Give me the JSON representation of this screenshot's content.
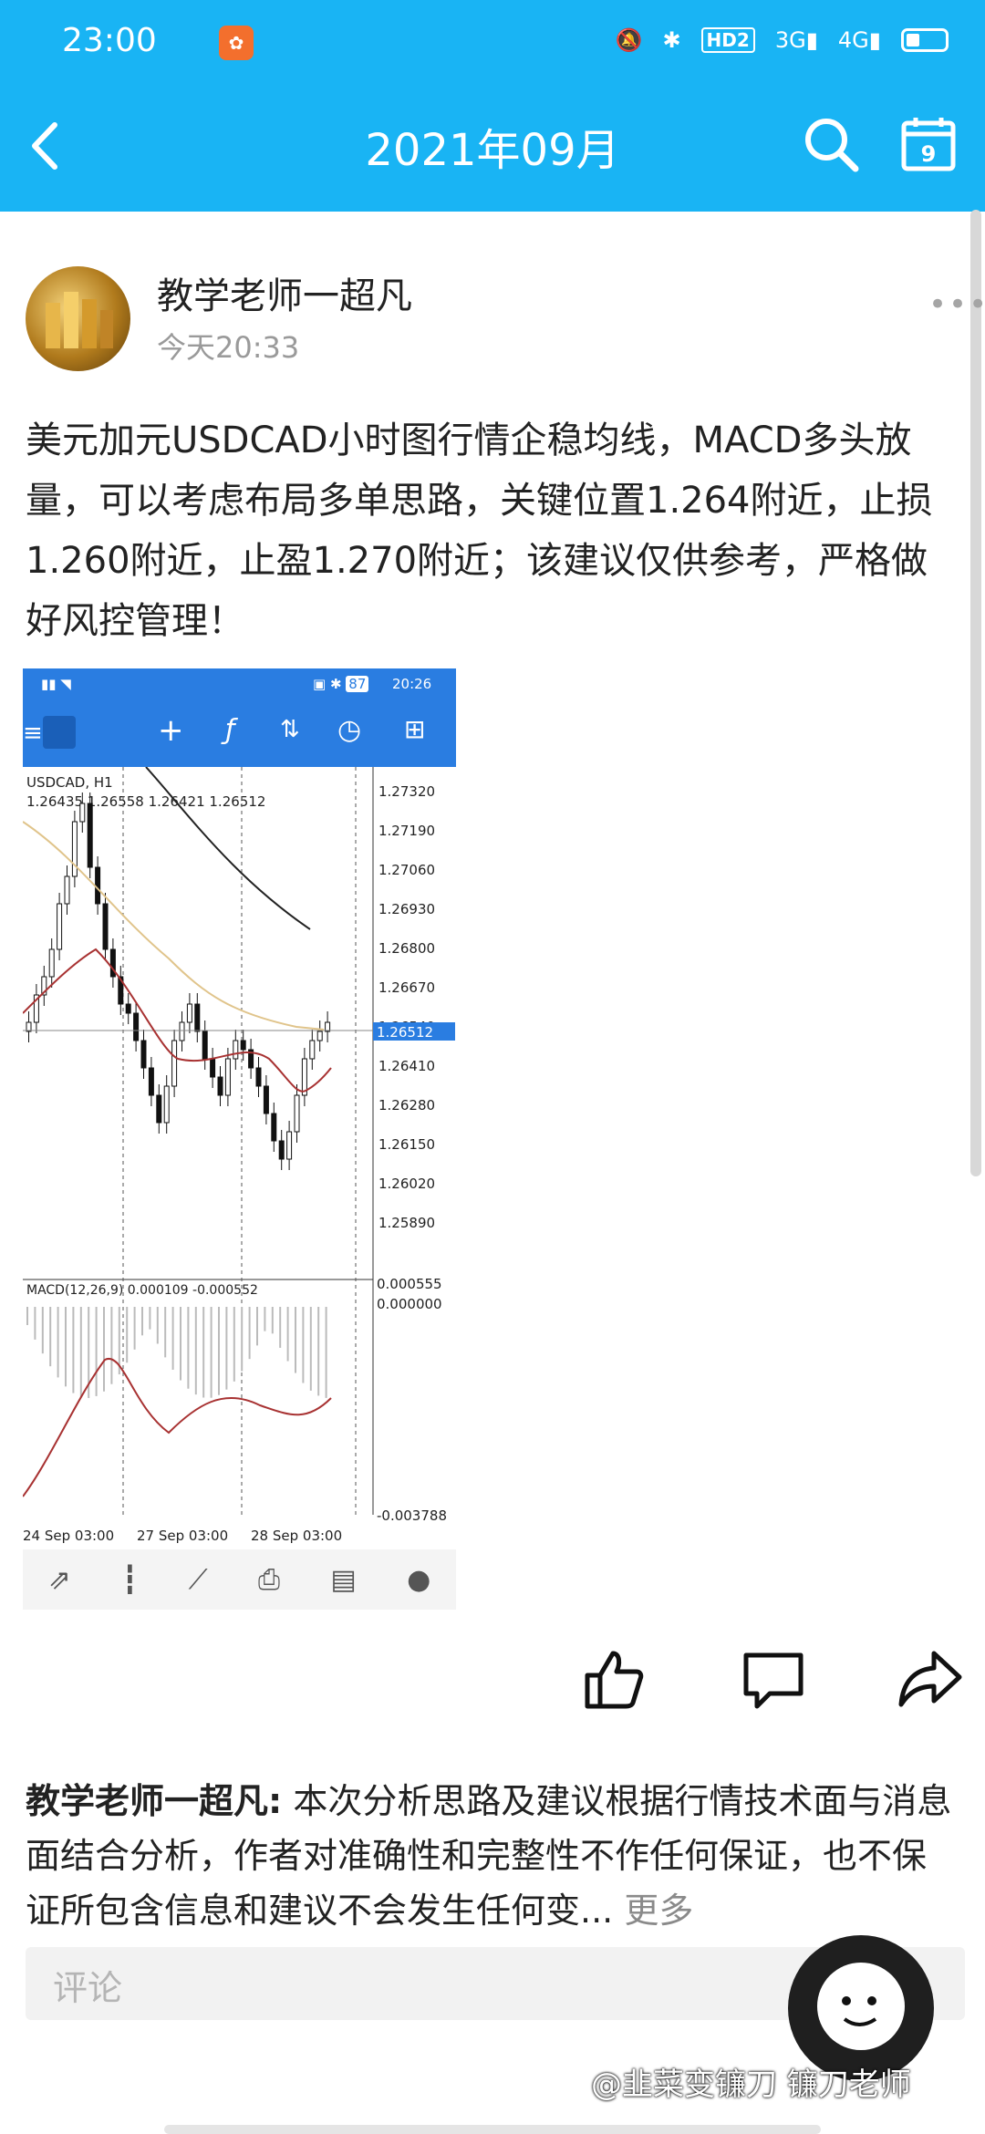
{
  "status_bar": {
    "time": "23:00",
    "network_hd": "HD2",
    "signal_3g": "3G",
    "signal_4g": "4G"
  },
  "nav": {
    "title": "2021年09月",
    "calendar_day": "9"
  },
  "post": {
    "author": "教学老师一超凡",
    "time": "今天20:33",
    "content": "美元加元USDCAD小时图行情企稳均线，MACD多头放量，可以考虑布局多单思路，关键位置1.264附近，止损1.260附近，止盈1.270附近；该建议仅供参考，严格做好风控管理！"
  },
  "screenshot": {
    "status_time": "20:26",
    "battery_text": "87",
    "symbol": "USDCAD, H1",
    "ohlc": "1.26435 1.26558 1.26421 1.26512",
    "current_price": "1.26512",
    "price_ticks": [
      "1.27320",
      "1.27190",
      "1.27060",
      "1.26930",
      "1.26800",
      "1.26670",
      "1.26540",
      "1.26410",
      "1.26280",
      "1.26150",
      "1.26020",
      "1.25890"
    ],
    "macd_label": "MACD(12,26,9) 0.000109 -0.000552",
    "macd_ticks": [
      "0.000555",
      "0.000000",
      "-0.003788"
    ],
    "date_labels": [
      "24 Sep 03:00",
      "27 Sep 03:00",
      "28 Sep 03:00"
    ]
  },
  "comment": {
    "author": "教学老师一超凡",
    "text": "本次分析思路及建议根据行情技术面与消息面结合分析，作者对准确性和完整性不作任何保证，也不保证所包含信息和建议不会发生任何变...",
    "more": "更多",
    "placeholder": "评论"
  },
  "watermark": "@韭菜变镰刀 镰刀老师",
  "colors": {
    "header": "#19b4f4",
    "mt_header": "#2a7de1"
  }
}
